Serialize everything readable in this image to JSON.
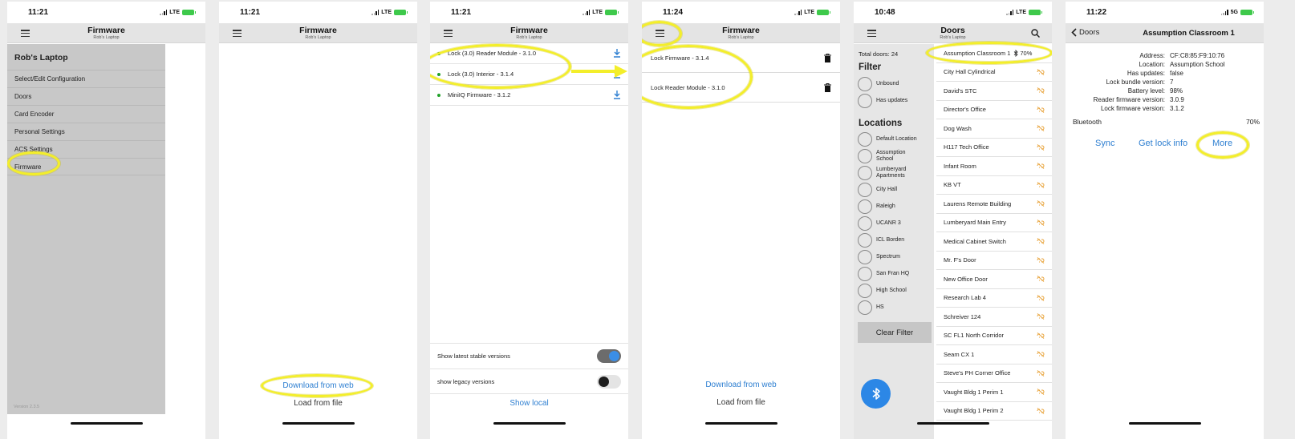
{
  "panel1": {
    "time": "11:21",
    "network": "LTE",
    "title": "Firmware",
    "subtitle": "Rob's Laptop",
    "menu_header": "Rob's Laptop",
    "menu_items": [
      "Select/Edit Configuration",
      "Doors",
      "Card Encoder",
      "Personal Settings",
      "ACS Settings",
      "Firmware"
    ],
    "version": "Version 2.3.5"
  },
  "panel2": {
    "time": "11:21",
    "network": "LTE",
    "title": "Firmware",
    "subtitle": "Rob's Laptop",
    "download_link": "Download from web",
    "load_file": "Load from file"
  },
  "panel3": {
    "time": "11:21",
    "network": "LTE",
    "title": "Firmware",
    "subtitle": "Rob's Laptop",
    "firmware_items": [
      "Lock (3.0) Reader Module - 3.1.0",
      "Lock (3.0) Interior - 3.1.4",
      "MiniIQ Firmware - 3.1.2"
    ],
    "toggle_stable": "Show latest stable versions",
    "toggle_legacy": "show legacy versions",
    "show_local": "Show local"
  },
  "panel4": {
    "time": "11:24",
    "network": "LTE",
    "title": "Firmware",
    "subtitle": "Rob's Laptop",
    "lock_items": [
      "Lock Firmware - 3.1.4",
      "Lock Reader Module - 3.1.0"
    ],
    "download_link": "Download from web",
    "load_file": "Load from file"
  },
  "panel5": {
    "time": "10:48",
    "network": "LTE",
    "title": "Doors",
    "subtitle": "Rob's Laptop",
    "total_doors": "Total doors: 24",
    "filter_heading": "Filter",
    "filters": [
      "Unbound",
      "Has updates"
    ],
    "locations_heading": "Locations",
    "locations": [
      "Default Location",
      "Assumption School",
      "Lumberyard Apartments",
      "City Hall",
      "Raleigh",
      "UCANR 3",
      "ICL Borden",
      "Spectrum",
      "San Fran HQ",
      "High School",
      "HS"
    ],
    "clear_filter": "Clear Filter",
    "first_door": "Assumption Classroom 1",
    "first_door_badge": "70%",
    "doors": [
      "City Hall Cylindrical",
      "David's STC",
      "Director's Office",
      "Dog Wash",
      "H117 Tech Office",
      "Infant Room",
      "KB VT",
      "Laurens Remote Building",
      "Lumberyard Main Entry",
      "Medical Cabinet Switch",
      "Mr. F's Door",
      "New Office Door",
      "Research Lab 4",
      "Schreiver 124",
      "SC FL1 North Corridor",
      "Seam CX 1",
      "Steve's PH Corner Office",
      "Vaught Bldg 1 Perim 1",
      "Vaught Bldg 1 Perim 2"
    ]
  },
  "panel6": {
    "time": "11:22",
    "network": "5G",
    "back_label": "Doors",
    "title": "Assumption Classroom 1",
    "info": [
      {
        "label": "Address:",
        "value": "CF:C8:85:F9:10:76"
      },
      {
        "label": "Location:",
        "value": "Assumption School"
      },
      {
        "label": "Has updates:",
        "value": "false"
      },
      {
        "label": "Lock bundle version:",
        "value": "7"
      },
      {
        "label": "Battery level:",
        "value": "98%"
      },
      {
        "label": "Reader firmware version:",
        "value": "3.0.9"
      },
      {
        "label": "Lock firmware version:",
        "value": "3.1.2"
      }
    ],
    "bluetooth_label": "Bluetooth",
    "bluetooth_value": "70%",
    "actions": [
      "Sync",
      "Get lock info",
      "More"
    ]
  },
  "colors": {
    "accent": "#2e7fd1",
    "highlight": "#f3ee2a",
    "door_icon": "#e8a33a",
    "bluetooth": "#2c87e6",
    "toggle_on": "#3b8ee6"
  }
}
